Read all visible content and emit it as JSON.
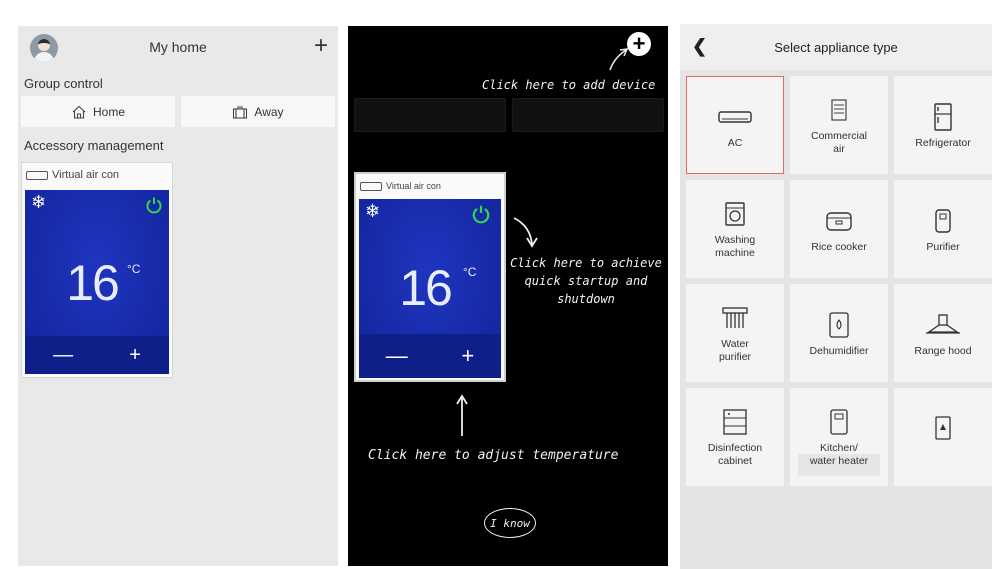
{
  "left_panel": {
    "title": "My home",
    "add_symbol": "+",
    "group_control_label": "Group control",
    "home_label": "Home",
    "away_label": "Away",
    "accessory_label": "Accessory management",
    "card": {
      "name": "Virtual air con",
      "temperature": "16",
      "unit": "°C",
      "minus": "—",
      "plus": "+"
    }
  },
  "middle_panel": {
    "add_hint": "Click here to add device",
    "startup_hint": "Click here to achieve quick startup and shutdown",
    "temp_hint": "Click here to adjust temperature",
    "iknow": "I know",
    "card": {
      "name": "Virtual air con",
      "temperature": "16",
      "unit": "°C",
      "minus": "—",
      "plus": "+"
    }
  },
  "right_panel": {
    "title": "Select appliance type",
    "appliances": [
      {
        "label": "AC",
        "icon": "ac-icon",
        "selected": true
      },
      {
        "label": "Commercial air",
        "icon": "commercial-air-icon"
      },
      {
        "label": "Refrigerator",
        "icon": "refrigerator-icon"
      },
      {
        "label": "Washing machine",
        "icon": "washing-machine-icon"
      },
      {
        "label": "Rice cooker",
        "icon": "rice-cooker-icon"
      },
      {
        "label": "Purifier",
        "icon": "purifier-icon"
      },
      {
        "label": "Water purifier",
        "icon": "water-purifier-icon"
      },
      {
        "label": "Dehumidifier",
        "icon": "dehumidifier-icon"
      },
      {
        "label": "Range hood",
        "icon": "range-hood-icon"
      },
      {
        "label": "Disinfection cabinet",
        "icon": "disinfection-cabinet-icon"
      },
      {
        "label": "Kitchen/ water heater",
        "icon": "water-heater-icon"
      },
      {
        "label": "",
        "icon": "device-icon"
      }
    ]
  },
  "colors": {
    "screen_blue": "#172aa8",
    "power_green": "#3ad34a",
    "selected_border": "#e06a6a"
  }
}
